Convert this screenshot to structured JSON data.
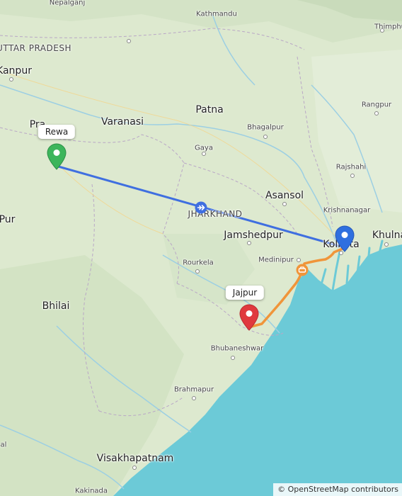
{
  "map": {
    "region_labels": [
      "UTTAR PRADESH",
      "JHARKHAND"
    ],
    "cities_large": [
      "Varanasi",
      "Patna",
      "Asansol",
      "Jamshedpur",
      "Bhilai",
      "Visakhapatnam",
      "Kolkata",
      "Khulna",
      "Kanpur",
      "Pur"
    ],
    "cities_small": [
      "Kathmandu",
      "Thimphu",
      "Rangpur",
      "Bhagalpur",
      "Gaya",
      "Rajshahi",
      "Krishnanagar",
      "Medinipur",
      "Rourkela",
      "Bhubaneshwar",
      "Brahmapur",
      "Kakinada",
      "Nepalganj",
      "Pra",
      "al"
    ],
    "attribution": "© OpenStreetMap contributors"
  },
  "markers": {
    "origin": {
      "label": "Rewa",
      "color": "#3cb55b"
    },
    "destination_flight": {
      "label": "Kolkata",
      "color": "#2f6fdf"
    },
    "destination_road": {
      "label": "Jajpur",
      "color": "#e0393e"
    }
  },
  "routes": {
    "flight": {
      "color": "#3f6fe0",
      "icon": "airplane-icon"
    },
    "drive": {
      "color": "#f0953a",
      "icon": "car-icon"
    }
  }
}
